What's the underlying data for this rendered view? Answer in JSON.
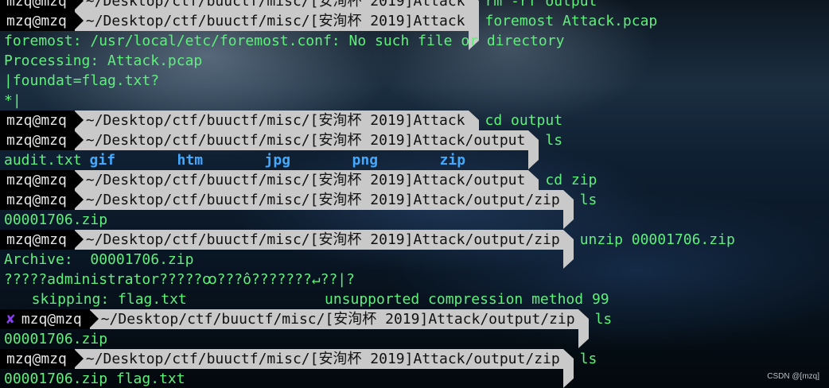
{
  "terminal": {
    "user": "mzq@mzq",
    "error_mark": "✘",
    "lines": [
      {
        "kind": "prompt",
        "path": "~/Desktop/ctf/buuctf/misc/[安洵杯 2019]Attack",
        "cmd": "rm -rf output"
      },
      {
        "kind": "prompt",
        "path": "~/Desktop/ctf/buuctf/misc/[安洵杯 2019]Attack",
        "cmd": "foremost Attack.pcap"
      },
      {
        "kind": "output",
        "text": "foremost: /usr/local/etc/foremost.conf: No such file or directory"
      },
      {
        "kind": "output",
        "text": "Processing: Attack.pcap"
      },
      {
        "kind": "output",
        "text": "|foundat=flag.txt?"
      },
      {
        "kind": "output",
        "text": "*|"
      },
      {
        "kind": "prompt",
        "path": "~/Desktop/ctf/buuctf/misc/[安洵杯 2019]Attack",
        "cmd": "cd output"
      },
      {
        "kind": "prompt",
        "path": "~/Desktop/ctf/buuctf/misc/[安洵杯 2019]Attack/output",
        "cmd": "ls"
      },
      {
        "kind": "listing",
        "file": "audit.txt",
        "dirs": [
          "gif",
          "htm",
          "jpg",
          "png",
          "zip"
        ]
      },
      {
        "kind": "prompt",
        "path": "~/Desktop/ctf/buuctf/misc/[安洵杯 2019]Attack/output",
        "cmd": "cd zip"
      },
      {
        "kind": "prompt",
        "path": "~/Desktop/ctf/buuctf/misc/[安洵杯 2019]Attack/output/zip",
        "cmd": "ls"
      },
      {
        "kind": "output",
        "text": "00001706.zip"
      },
      {
        "kind": "prompt",
        "path": "~/Desktop/ctf/buuctf/misc/[安洵杯 2019]Attack/output/zip",
        "cmd": "unzip 00001706.zip"
      },
      {
        "kind": "output",
        "text": "Archive:  00001706.zip"
      },
      {
        "kind": "output",
        "text": "?????administrator?????ꝏ???ô???????↵??|?"
      },
      {
        "kind": "skip",
        "text": "  skipping: flag.txt",
        "reason": "unsupported compression method 99"
      },
      {
        "kind": "prompt",
        "error": true,
        "path": "~/Desktop/ctf/buuctf/misc/[安洵杯 2019]Attack/output/zip",
        "cmd": "ls"
      },
      {
        "kind": "output",
        "text": "00001706.zip"
      },
      {
        "kind": "prompt",
        "path": "~/Desktop/ctf/buuctf/misc/[安洵杯 2019]Attack/output/zip",
        "cmd": "ls"
      },
      {
        "kind": "output",
        "text": "00001706.zip flag.txt"
      }
    ]
  },
  "colors": {
    "text_green": "#5ff07c",
    "dir_blue": "#43a9ff",
    "prompt_bg_dark": "#000000",
    "prompt_bg_light": "#c9c9c9",
    "error_purple": "#8a3ff0"
  },
  "watermark": "CSDN @[mzq]"
}
